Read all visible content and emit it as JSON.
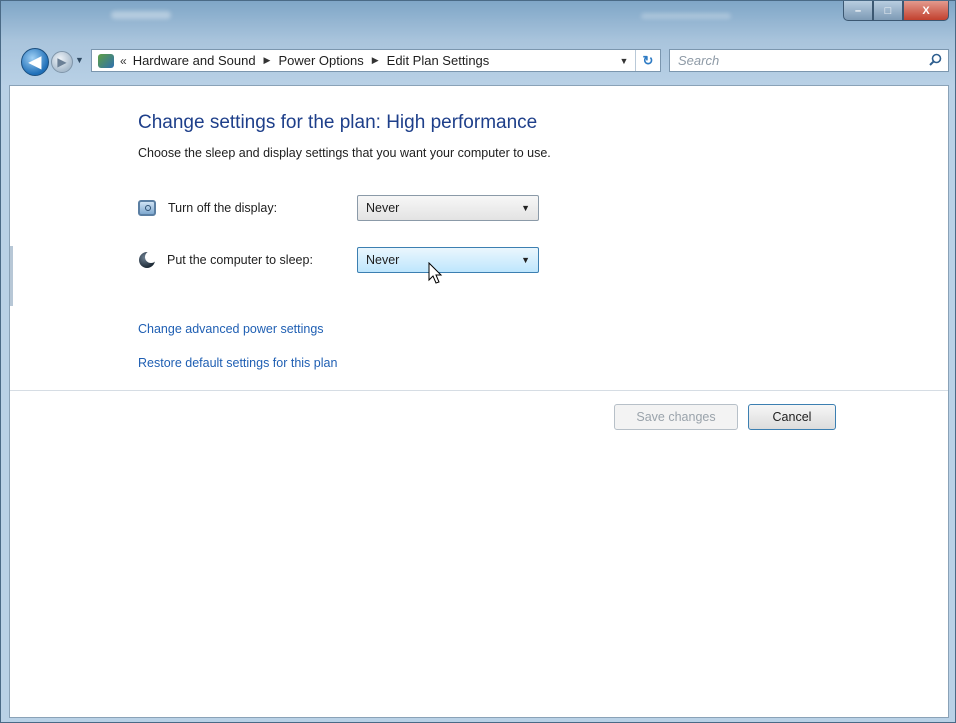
{
  "window": {
    "caption": {
      "minimize": "–",
      "maximize": "□",
      "close": "X"
    }
  },
  "nav": {
    "back": "◀",
    "forward": "▶",
    "history_drop": "▼",
    "overflow": "«",
    "breadcrumbs": [
      "Hardware and Sound",
      "Power Options",
      "Edit Plan Settings"
    ],
    "separator": "▶",
    "address_drop": "▼",
    "refresh": "↻",
    "search_placeholder": "Search"
  },
  "page": {
    "title": "Change settings for the plan: High performance",
    "subtitle": "Choose the sleep and display settings that you want your computer to use.",
    "settings": [
      {
        "icon": "display-icon",
        "label": "Turn off the display:",
        "value": "Never"
      },
      {
        "icon": "sleep-icon",
        "label": "Put the computer to sleep:",
        "value": "Never"
      }
    ],
    "links": [
      "Change advanced power settings",
      "Restore default settings for this plan"
    ],
    "buttons": {
      "save": "Save changes",
      "cancel": "Cancel"
    }
  },
  "colors": {
    "title": "#1e3f8a",
    "link": "#1f5fb3",
    "accent": "#3c7fb1"
  }
}
